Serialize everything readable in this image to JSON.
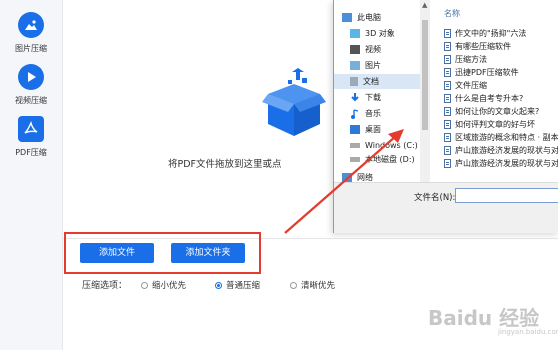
{
  "sidebar": {
    "items": [
      {
        "label": "图片压缩",
        "icon": "image-icon"
      },
      {
        "label": "视频压缩",
        "icon": "play-icon"
      },
      {
        "label": "PDF压缩",
        "icon": "pdf-icon"
      }
    ]
  },
  "main": {
    "drop_hint": "将PDF文件拖放到这里或点",
    "add_file": "添加文件",
    "add_folder": "添加文件夹",
    "options_label": "压缩选项：",
    "options": [
      {
        "label": "缩小优先",
        "selected": false
      },
      {
        "label": "普通压缩",
        "selected": true
      },
      {
        "label": "清晰优先",
        "selected": false
      }
    ]
  },
  "dialog": {
    "nav": [
      {
        "label": "此电脑",
        "icon": "computer-icon"
      },
      {
        "label": "3D 对象",
        "icon": "cube-icon"
      },
      {
        "label": "视频",
        "icon": "video-icon"
      },
      {
        "label": "图片",
        "icon": "picture-icon"
      },
      {
        "label": "文档",
        "icon": "document-icon",
        "selected": true
      },
      {
        "label": "下载",
        "icon": "download-icon"
      },
      {
        "label": "音乐",
        "icon": "music-icon"
      },
      {
        "label": "桌面",
        "icon": "desktop-icon"
      },
      {
        "label": "Windows (C:)",
        "icon": "drive-icon"
      },
      {
        "label": "本地磁盘 (D:)",
        "icon": "drive-icon"
      },
      {
        "label": "网络",
        "icon": "network-icon"
      }
    ],
    "column_header": "名称",
    "files": [
      "作文中的\"扬抑\"六法",
      "有哪些压缩软件",
      "压缩方法",
      "迅捷PDF压缩软件",
      "文件压缩",
      "什么是自考专升本?",
      "如何让你的文章火起来?",
      "如何评判文章的好与坏",
      "区域旅游的概念和特点 · 副本",
      "庐山旅游经济发展的现状与对策",
      "庐山旅游经济发展的现状与对策"
    ],
    "filename_label": "文件名(N):",
    "filename_value": ""
  },
  "watermark": {
    "brand": "Baidu 经验",
    "sub": "jingyan.baidu.com"
  },
  "colors": {
    "accent": "#1a6fe8",
    "highlight": "#e43b2f",
    "selected_nav": "#d9e6f5"
  }
}
